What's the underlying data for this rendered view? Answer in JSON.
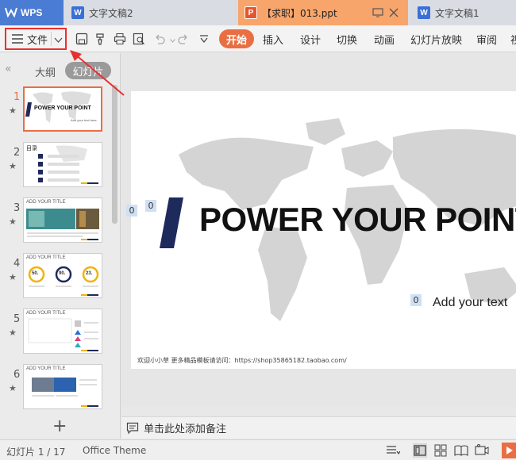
{
  "tabs": {
    "app": "WPS",
    "doc2": "文字文稿2",
    "presentation": "【求职】013.ppt",
    "doc1": "文字文稿1"
  },
  "ribbon": {
    "file_menu": "文件",
    "items": [
      "开始",
      "插入",
      "设计",
      "切换",
      "动画",
      "幻灯片放映",
      "审阅",
      "视"
    ]
  },
  "left_panel": {
    "tab_outline": "大纲",
    "tab_slides": "幻灯片",
    "slides": [
      {
        "num": "1",
        "mini_title": "POWER YOUR POINT",
        "mini_sub": "Add your text here"
      },
      {
        "num": "2",
        "mini_title": "目录"
      },
      {
        "num": "3",
        "mini_title": "ADD YOUR TITLE"
      },
      {
        "num": "4",
        "mini_title": "ADD YOUR TITLE",
        "stats": [
          "50.",
          "90.",
          "23."
        ]
      },
      {
        "num": "5",
        "mini_title": "ADD YOUR TITLE"
      },
      {
        "num": "6",
        "mini_title": "ADD YOUR TITLE"
      }
    ],
    "add_symbol": "+"
  },
  "slide": {
    "title": "POWER YOUR POINT",
    "subtitle": "Add your text",
    "box_left": "0",
    "box_title": "0",
    "box_subtitle": "0",
    "footer": "欢迎小小草 更多精品模板请访问：https://shop35865182.taobao.com/"
  },
  "notes": {
    "placeholder": "单击此处添加备注"
  },
  "status": {
    "slide_counter": "幻灯片 1 / 17",
    "theme": "Office Theme"
  },
  "colors": {
    "accent": "#e96e43",
    "annotation": "#e8312f",
    "navy": "#1f2a5c",
    "tab_active": "#f7a56b",
    "wps_blue": "#4a7cd3"
  },
  "icons": [
    "menu-icon",
    "chevron-down-icon",
    "save-icon",
    "format-painter-icon",
    "print-icon",
    "print-preview-icon",
    "undo-icon",
    "redo-icon",
    "customize-icon",
    "restore-window-icon",
    "close-icon",
    "note-icon",
    "normal-view-icon",
    "slide-sorter-icon",
    "reading-view-icon",
    "presenter-view-icon",
    "play-icon"
  ]
}
